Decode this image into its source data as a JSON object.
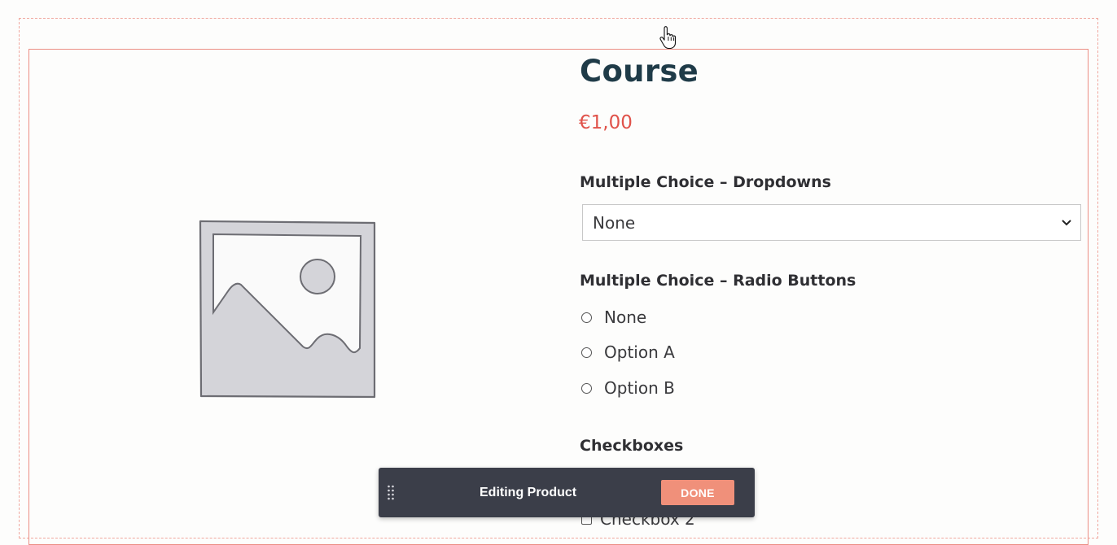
{
  "product": {
    "title": "Course",
    "price": "€1,00"
  },
  "dropdown_field": {
    "label": "Multiple Choice – Dropdowns",
    "selected": "None"
  },
  "radio_field": {
    "label": "Multiple Choice – Radio Buttons",
    "options": [
      "None",
      "Option A",
      "Option B"
    ]
  },
  "checkbox_field": {
    "label": "Checkboxes",
    "options": [
      "Checkbox 2"
    ]
  },
  "toolbar": {
    "title": "Editing Product",
    "done_label": "DONE"
  },
  "colors": {
    "title": "#1f3b48",
    "price": "#e0524a",
    "toolbar_bg": "#3b3e49",
    "done_bg": "#f0907a",
    "selection_border": "#ec8d84"
  },
  "icons": [
    "pointer-hand-icon",
    "image-placeholder-icon",
    "chevron-down-icon",
    "drag-handle-icon"
  ]
}
